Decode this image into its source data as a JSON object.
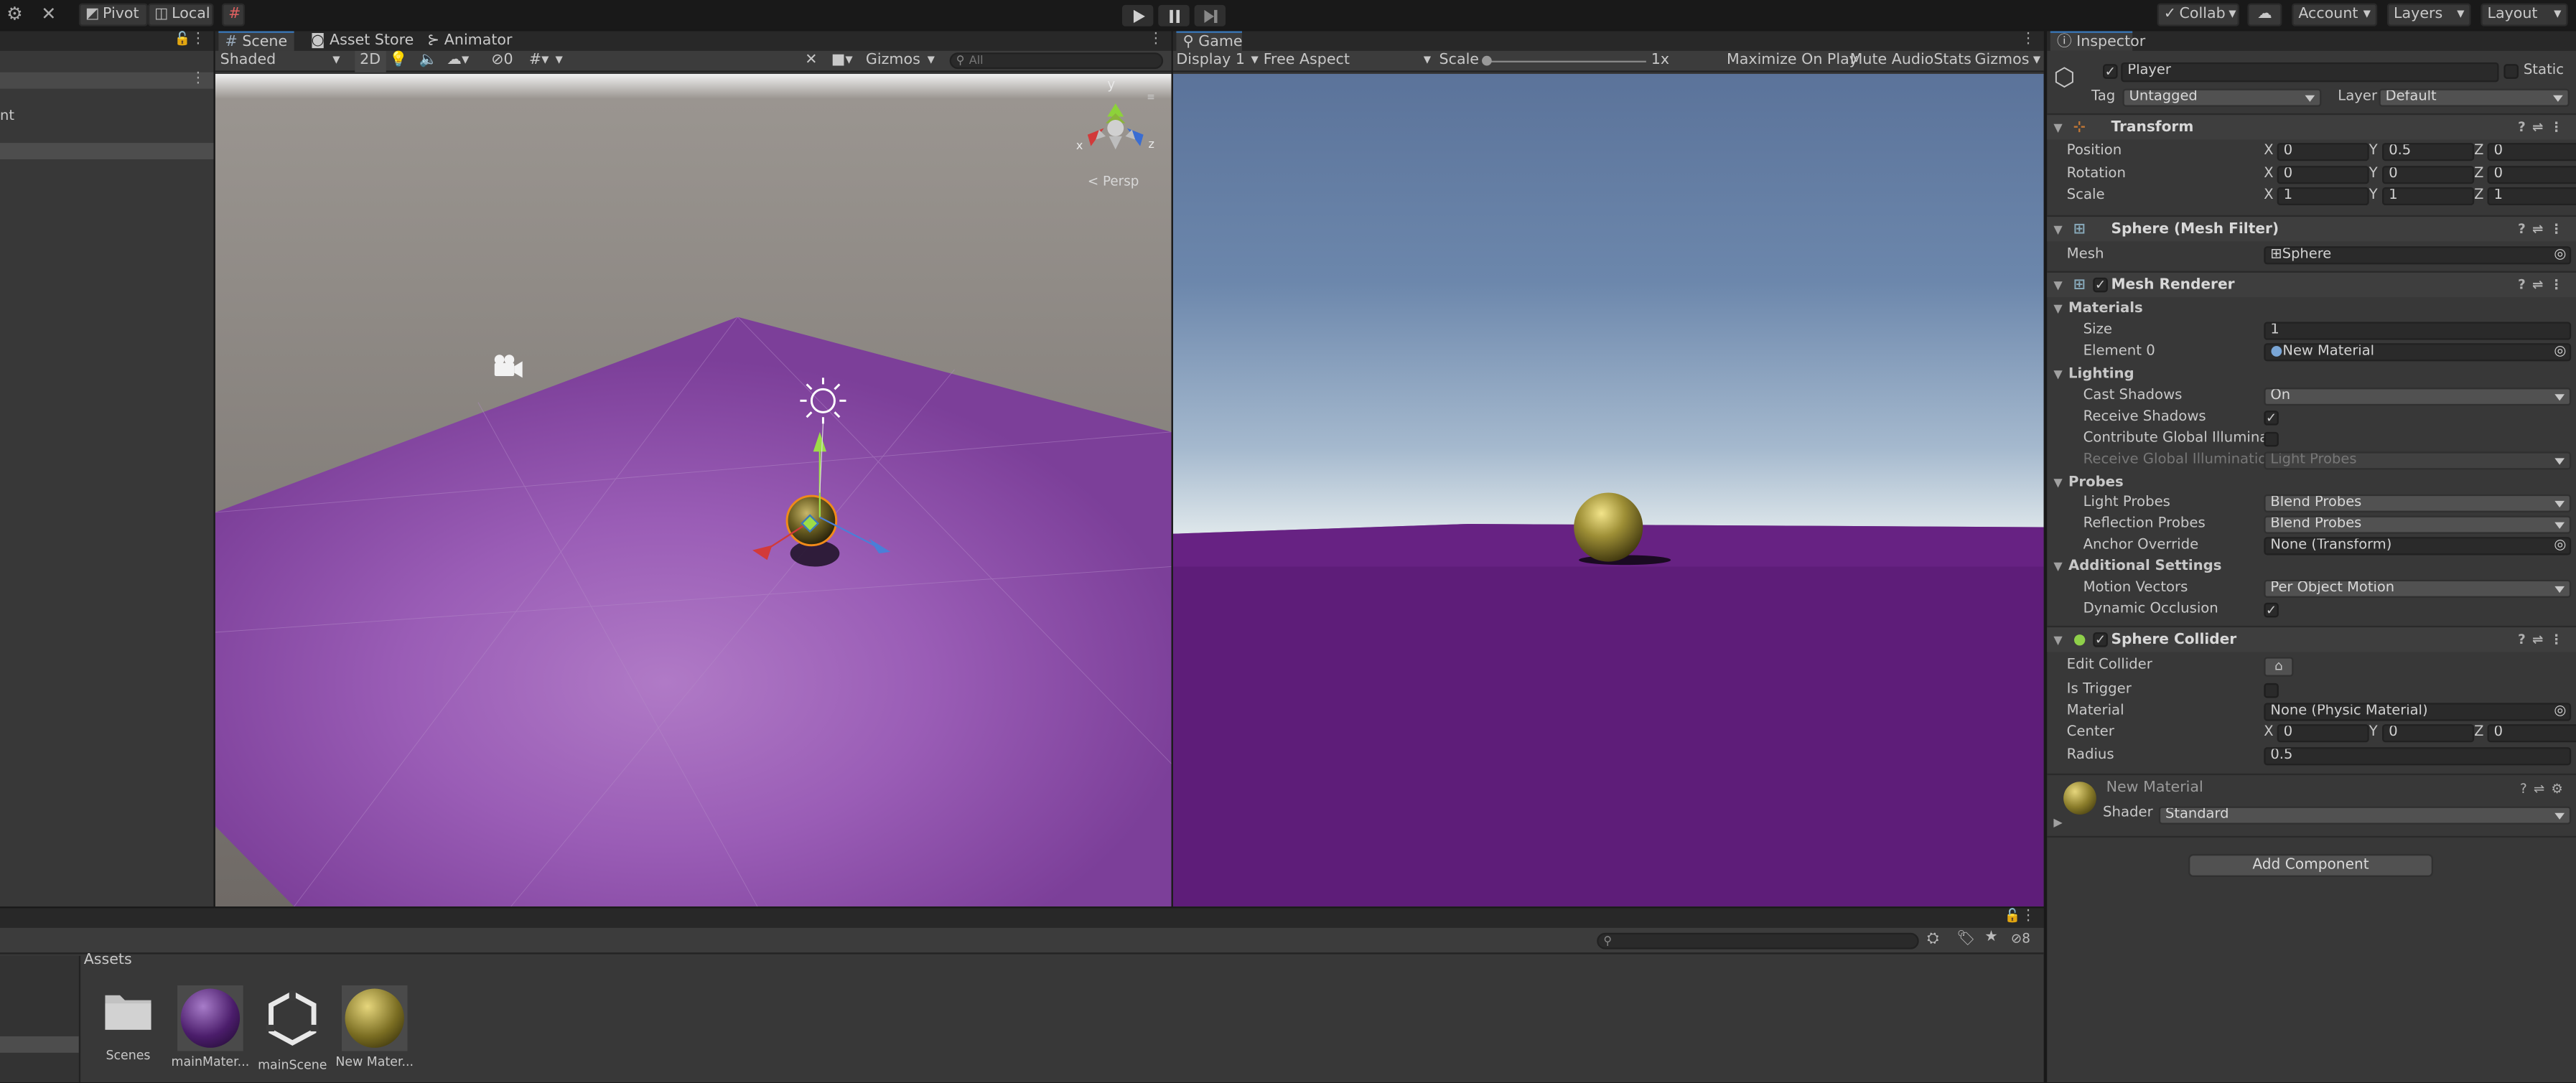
{
  "colors": {
    "accent": "#3a79bb",
    "selection": "#f08a1a",
    "plane": "#8e44ad"
  },
  "toolbar": {
    "pivot": "Pivot",
    "local": "Local",
    "play_icon": "play-icon",
    "pause_icon": "pause-icon",
    "step_icon": "step-icon",
    "collab": "Collab",
    "account": "Account",
    "layers": "Layers",
    "layout": "Layout"
  },
  "hierarchy": {
    "item_partial": "nt"
  },
  "scene": {
    "tab_scene": "Scene",
    "tab_asset_store": "Asset Store",
    "tab_animator": "Animator",
    "shading": "Shaded",
    "btn_2d": "2D",
    "hidden_count": "0",
    "gizmos": "Gizmos",
    "search_placeholder": "All",
    "persp": "Persp",
    "axis_x": "x",
    "axis_y": "y",
    "axis_z": "z"
  },
  "game": {
    "tab": "Game",
    "display": "Display 1",
    "aspect": "Free Aspect",
    "scale_label": "Scale",
    "scale_value": "1x",
    "maximize": "Maximize On Play",
    "mute": "Mute Audio",
    "stats": "Stats",
    "gizmos": "Gizmos"
  },
  "inspector": {
    "tab": "Inspector",
    "object_name": "Player",
    "static": "Static",
    "tag_label": "Tag",
    "tag_value": "Untagged",
    "layer_label": "Layer",
    "layer_value": "Default",
    "transform": {
      "title": "Transform",
      "position": "Position",
      "rotation": "Rotation",
      "scale": "Scale",
      "pos": [
        "0",
        "0.5",
        "0"
      ],
      "rot": [
        "0",
        "0",
        "0"
      ],
      "scl": [
        "1",
        "1",
        "1"
      ]
    },
    "mesh_filter": {
      "title": "Sphere (Mesh Filter)",
      "mesh_label": "Mesh",
      "mesh_value": "Sphere"
    },
    "mesh_renderer": {
      "title": "Mesh Renderer",
      "materials": "Materials",
      "size_label": "Size",
      "size_value": "1",
      "element_label": "Element 0",
      "element_value": "New Material",
      "lighting": "Lighting",
      "cast_shadows": "Cast Shadows",
      "cast_shadows_value": "On",
      "receive_shadows": "Receive Shadows",
      "contribute_gi": "Contribute Global Illuminatic",
      "receive_gi": "Receive Global Illumination",
      "receive_gi_value": "Light Probes",
      "probes": "Probes",
      "light_probes": "Light Probes",
      "light_probes_value": "Blend Probes",
      "reflection_probes": "Reflection Probes",
      "reflection_probes_value": "Blend Probes",
      "anchor_override": "Anchor Override",
      "anchor_override_value": "None (Transform)",
      "additional": "Additional Settings",
      "motion_vectors": "Motion Vectors",
      "motion_vectors_value": "Per Object Motion",
      "dynamic_occlusion": "Dynamic Occlusion"
    },
    "sphere_collider": {
      "title": "Sphere Collider",
      "edit_collider": "Edit Collider",
      "is_trigger": "Is Trigger",
      "material": "Material",
      "material_value": "None (Physic Material)",
      "center": "Center",
      "center_vals": [
        "0",
        "0",
        "0"
      ],
      "radius": "Radius",
      "radius_value": "0.5"
    },
    "material": {
      "name": "New Material",
      "shader_label": "Shader",
      "shader_value": "Standard"
    },
    "add_component": "Add Component"
  },
  "project": {
    "assets_label": "Assets",
    "hidden_count": "8",
    "items": [
      {
        "name": "Scenes",
        "icon": "folder-icon"
      },
      {
        "name": "mainMater...",
        "icon": "purple-material-icon"
      },
      {
        "name": "mainScene",
        "icon": "unity-scene-icon"
      },
      {
        "name": "New Mater...",
        "icon": "yellow-material-icon"
      }
    ]
  }
}
